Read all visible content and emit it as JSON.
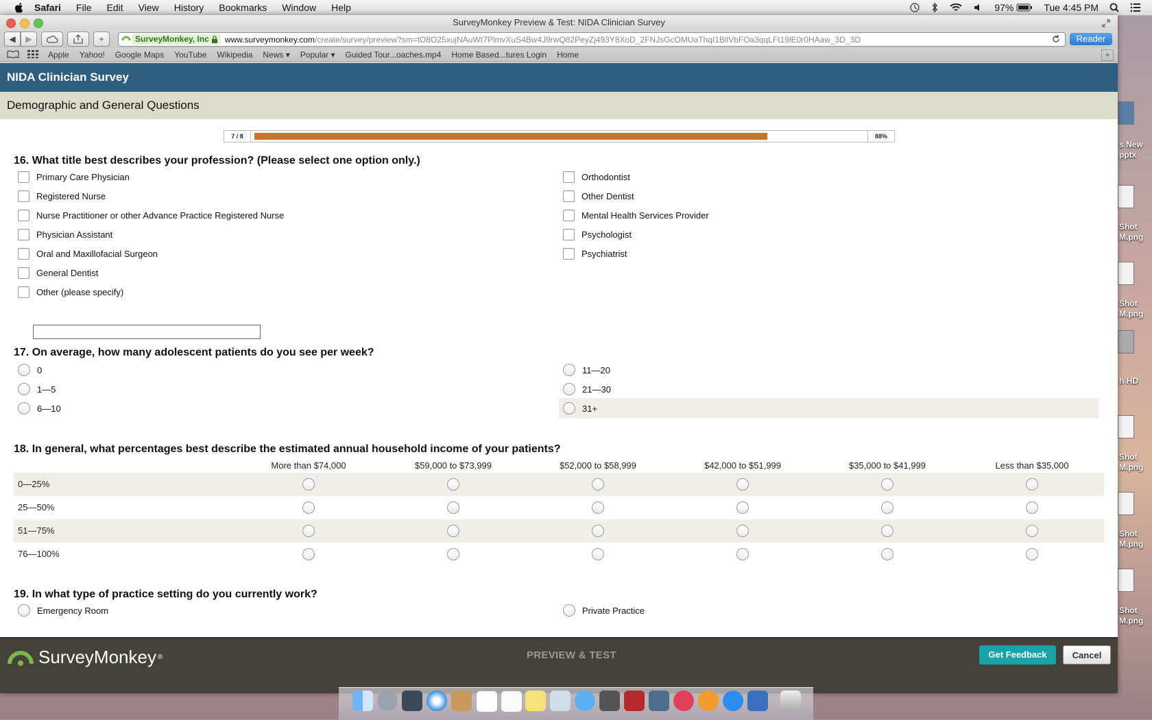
{
  "menubar": {
    "app": "Safari",
    "items": [
      "File",
      "Edit",
      "View",
      "History",
      "Bookmarks",
      "Window",
      "Help"
    ],
    "battery": "97%",
    "clock": "Tue 4:45 PM"
  },
  "window": {
    "title": "SurveyMonkey Preview & Test: NIDA Clinician Survey"
  },
  "toolbar": {
    "ssl_org": "SurveyMonkey, Inc",
    "url_host": "www.surveymonkey.com",
    "url_path": "/create/survey/preview?sm=tO8O25xujNAuWt7PlmvXuS4Bw4J9rwQ82PeyZj493Y8XoD_2FNJsGcOMUaThqI1BllVbFOa3qqLFt19lE0r0HAaw_3D_3D",
    "reader_label": "Reader"
  },
  "bookmarks": [
    "Apple",
    "Yahoo!",
    "Google Maps",
    "YouTube",
    "Wikipedia",
    "News ▾",
    "Popular ▾",
    "Guided Tour...oaches.mp4",
    "Home Based...tures Login",
    "Home"
  ],
  "survey": {
    "title": "NIDA Clinician Survey",
    "page_title": "Demographic and General Questions",
    "progress": {
      "label": "7 / 8",
      "percent_label": "88%",
      "fraction": 0.88
    }
  },
  "q16": {
    "text": "16. What title best describes your profession? (Please select one option only.)",
    "left": [
      "Primary Care Physician",
      "Registered Nurse",
      "Nurse Practitioner or other Advance Practice Registered Nurse",
      "Physician Assistant",
      "Oral and Maxillofacial Surgeon",
      "General Dentist",
      "Other (please specify)"
    ],
    "right": [
      "Orthodontist",
      "Other Dentist",
      "Mental Health Services Provider",
      "Psychologist",
      "Psychiatrist"
    ]
  },
  "q17": {
    "text": "17. On average, how many adolescent patients do you see per week?",
    "left": [
      "0",
      "1—5",
      "6—10"
    ],
    "right": [
      "11—20",
      "21—30",
      "31+"
    ]
  },
  "q18": {
    "text": "18. In general, what percentages best describe the estimated annual household income of your patients?",
    "columns": [
      "More than $74,000",
      "$59,000 to $73,999",
      "$52,000 to $58,999",
      "$42,000 to $51,999",
      "$35,000 to $41,999",
      "Less than $35,000"
    ],
    "rows": [
      "0—25%",
      "25—50%",
      "51—75%",
      "76—100%"
    ]
  },
  "q19": {
    "text": "19. In what type of practice setting do you currently work?",
    "left": [
      "Emergency Room"
    ],
    "right": [
      "Private Practice"
    ]
  },
  "footer": {
    "logo": "SurveyMonkey",
    "reg": "®",
    "mode": "PREVIEW & TEST",
    "feedback": "Get Feedback",
    "cancel": "Cancel"
  },
  "desktop_labels": [
    "s New\npptx",
    "Shot\nM.png",
    "Shot\nM.png",
    "h HD",
    "Shot\nM.png",
    "Shot\nM.png",
    "Shot\nM.png"
  ],
  "colors": {
    "header_blue": "#2e5f80",
    "page_header": "#dcdccb",
    "progress_fill": "#c8742f",
    "feedback_teal": "#18a3a8"
  }
}
